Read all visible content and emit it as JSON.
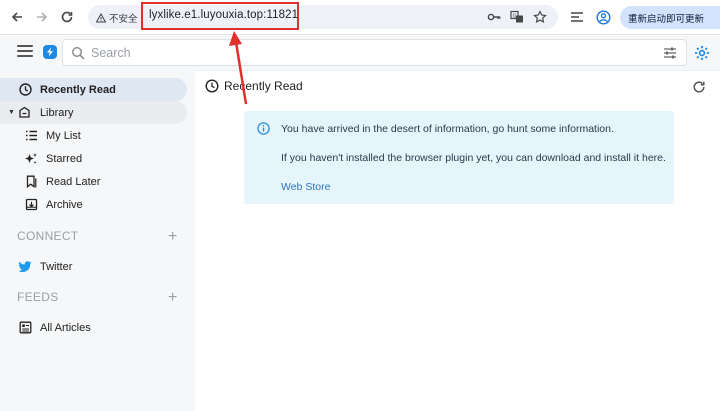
{
  "browser": {
    "security_label": "不安全",
    "url": "lyxlike.e1.luyouxia.top:11821",
    "update_label": "重新启动即可更新"
  },
  "header": {
    "search_placeholder": "Search"
  },
  "sidebar": {
    "recently_read": "Recently Read",
    "library": "Library",
    "library_items": [
      {
        "label": "My List",
        "icon": "list-icon"
      },
      {
        "label": "Starred",
        "icon": "sparkle-icon"
      },
      {
        "label": "Read Later",
        "icon": "bookmark-icon"
      },
      {
        "label": "Archive",
        "icon": "archive-icon"
      }
    ],
    "connect_heading": "CONNECT",
    "twitter": "Twitter",
    "feeds_heading": "FEEDS",
    "all_articles": "All Articles"
  },
  "main": {
    "title": "Recently Read",
    "info": {
      "line1": "You have arrived in the desert of information, go hunt some information.",
      "line2": "If you haven't installed the browser plugin yet, you can download and install it here.",
      "link": "Web Store"
    }
  },
  "colors": {
    "accent": "#1e88e5",
    "annotation": "#e0302e",
    "info_bg": "#e6f4fb"
  }
}
